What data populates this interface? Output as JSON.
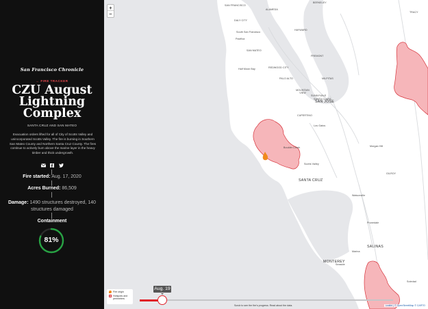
{
  "sidebar": {
    "brand": "San Francisco Chronicle",
    "back_link": "← FIRE TRACKER",
    "title": "CZU August Lightning Complex",
    "subtitle": "SANTA CRUZ AND SAN MATEO",
    "description": "Evacuation orders lifted for all of City of Scotts Valley and unincorporated Scotts Valley. The fire is burning in Southern San Mateo County and Northern Santa Cruz County. The fires continue to actively burn above the marine layer in the heavy timber and thick undergrowth.",
    "share_icons": [
      "email-icon",
      "facebook-icon",
      "twitter-icon"
    ],
    "fire_started_label": "Fire started:",
    "fire_started_value": "Aug. 17, 2020",
    "acres_label": "Acres Burned:",
    "acres_value": "86,509",
    "damage_label": "Damage:",
    "damage_value": "1490 structures destroyed, 140 structures damaged",
    "containment_label": "Containment",
    "containment_value": "81%",
    "containment_fraction": 0.81,
    "colors": {
      "background": "#101010",
      "accent": "#e8474c",
      "ring": "#27a243"
    }
  },
  "map": {
    "zoom_in": "+",
    "zoom_out": "−",
    "labels": {
      "san_francisco": "SAN FRANCISCO",
      "alameda": "ALAMEDA",
      "berkeley": "BERKELEY",
      "daly_city": "DALY CITY",
      "hayward": "HAYWARD",
      "south_sf": "South San Francisco",
      "pacifica": "Pacifica",
      "san_mateo": "SAN MATEO",
      "fremont": "FREMONT",
      "redwood_city": "REDWOOD CITY",
      "half_moon_bay": "Half Moon Bay",
      "palo_alto": "PALO ALTO",
      "milpitas": "MILPITAS",
      "mountain_view": "MOUNTAIN VIEW",
      "sunnyvale": "SUNNYVALE",
      "santa_clara": "SANTA CLARA",
      "san_jose": "SAN JOSE",
      "cupertino": "CUPERTINO",
      "los_gatos": "Los Gatos",
      "morgan_hill": "Morgan Hill",
      "boulder_creek": "Boulder Creek",
      "scotts_valley": "Scotts Valley",
      "santa_cruz": "SANTA CRUZ",
      "gilroy": "GILROY",
      "watsonville": "Watsonville",
      "prunedale": "Prunedale",
      "salinas": "SALINAS",
      "marina": "Marina",
      "monterey": "MONTEREY",
      "seaside": "Seaside",
      "tracy": "TRACY",
      "soledad": "Soledad"
    },
    "legend": {
      "origin": "Fire origin",
      "perimeter": "Hotspots and perimeters"
    },
    "colors": {
      "perimeter_fill": "#f6b6ba",
      "perimeter_stroke": "#d7343c",
      "land": "#ffffff",
      "water": "#e6e7ea",
      "origin": "#f08a1c"
    }
  },
  "timeline": {
    "date_label": "Aug. 19",
    "hint": "Scrub to see the fire's progress. Read about the data.",
    "progress_fraction": 0.09,
    "attribution": "Leaflet | © OpenStreetMap © CARTO"
  }
}
